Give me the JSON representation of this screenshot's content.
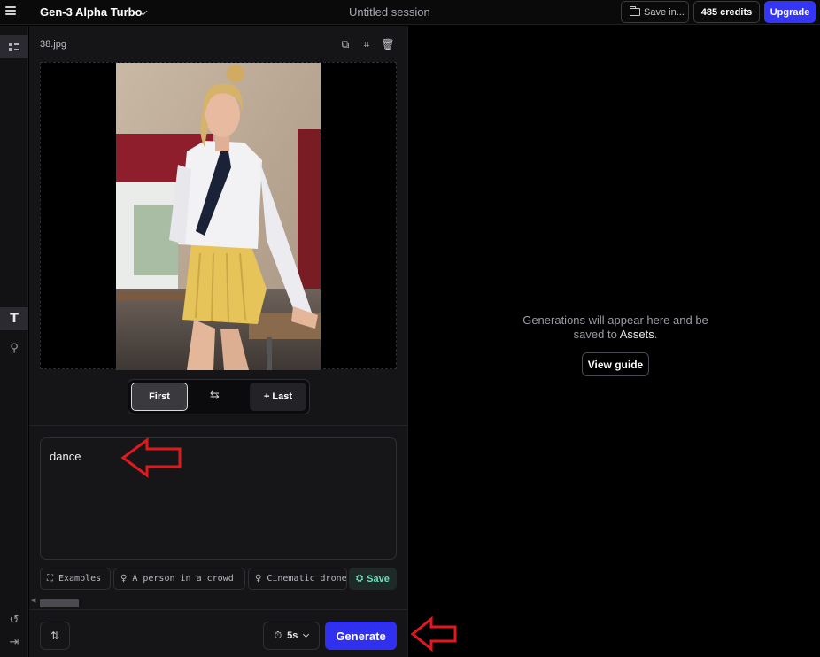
{
  "header": {
    "model_name": "Gen-3 Alpha Turbo",
    "session_title": "Untitled session",
    "save_label": "Save in...",
    "credits_label": "485 credits",
    "upgrade_label": "Upgrade"
  },
  "rail": {
    "items": [
      {
        "name": "assets-panel",
        "icon": "grid-list-icon"
      },
      {
        "name": "text-tool",
        "icon": "text-icon"
      },
      {
        "name": "magic-tool",
        "icon": "wand-icon"
      },
      {
        "name": "reset",
        "icon": "undo-icon"
      },
      {
        "name": "collapse",
        "icon": "collapse-icon"
      }
    ]
  },
  "panel": {
    "filename": "38.jpg",
    "tools": [
      "duplicate-icon",
      "crop-icon",
      "trash-icon"
    ],
    "frame_toggle": {
      "first_label": "First",
      "last_label": "+ Last"
    },
    "prompt": {
      "value": "dance"
    },
    "chips": [
      {
        "icon": "examples-icon",
        "label": "Examples"
      },
      {
        "icon": "lightbulb-icon",
        "label": "A person in a crowd"
      },
      {
        "icon": "lightbulb-icon",
        "label": "Cinematic drone"
      }
    ],
    "save_chip_label": "Save",
    "duration_label": "5s",
    "generate_label": "Generate"
  },
  "output": {
    "empty_line1": "Generations will appear here and be",
    "empty_line2_prefix": "saved to ",
    "empty_line2_link": "Assets",
    "empty_line2_suffix": ".",
    "view_guide_label": "View guide"
  },
  "colors": {
    "accent": "#3535f5",
    "save_green": "#6fe0b8",
    "annotation_red": "#e0191f"
  }
}
